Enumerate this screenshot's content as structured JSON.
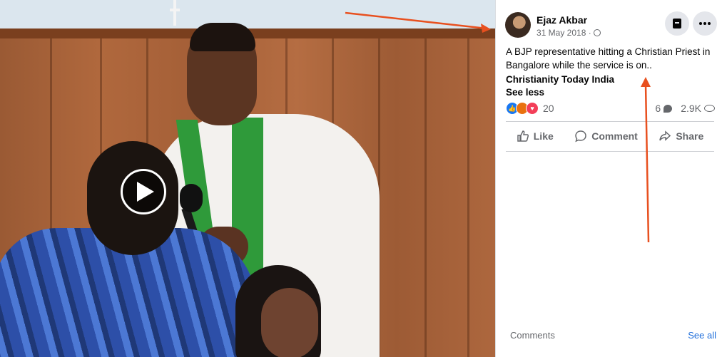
{
  "post": {
    "author": "Ejaz Akbar",
    "date": "31 May 2018 ·",
    "text": "A BJP representative hitting a Christian Priest in Bangalore while the service is on..",
    "page_link": "Christianity Today India",
    "see_less": "See less",
    "reaction_count": "20",
    "comment_count": "6",
    "view_count": "2.9K",
    "actions": {
      "like": "Like",
      "comment": "Comment",
      "share": "Share"
    }
  },
  "comments": {
    "label": "Comments",
    "see_all": "See all"
  },
  "icons": {
    "privacy": "globe-icon",
    "save": "bookmark-icon",
    "more": "more-icon",
    "play": "play-icon",
    "like": "thumbs-up-icon",
    "comment": "comment-icon",
    "share": "share-icon"
  },
  "colors": {
    "link": "#216fdb",
    "annotation_arrow": "#e8501f",
    "like_blue": "#1877f2",
    "love_red": "#f33e58",
    "angry_orange": "#e9710f"
  }
}
